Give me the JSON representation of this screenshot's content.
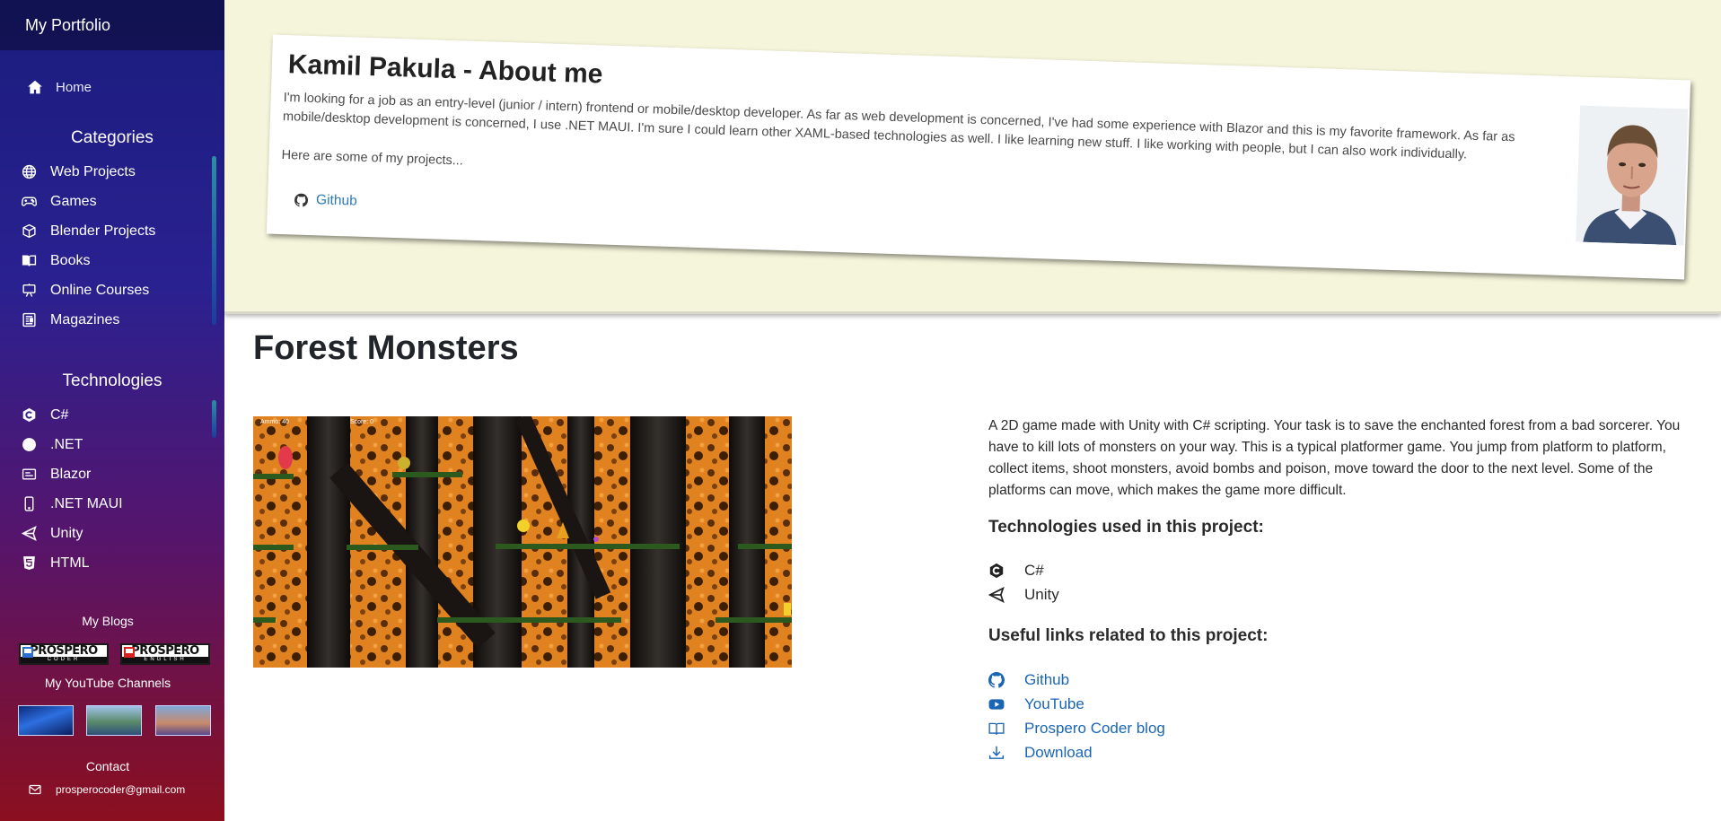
{
  "sidebar": {
    "brand": "My Portfolio",
    "home": "Home",
    "categories_title": "Categories",
    "categories": [
      {
        "label": "Web Projects",
        "icon": "globe-icon"
      },
      {
        "label": "Games",
        "icon": "gamepad-icon"
      },
      {
        "label": "Blender Projects",
        "icon": "box-icon"
      },
      {
        "label": "Books",
        "icon": "book-icon"
      },
      {
        "label": "Online Courses",
        "icon": "easel-icon"
      },
      {
        "label": "Magazines",
        "icon": "newspaper-icon"
      }
    ],
    "technologies_title": "Technologies",
    "technologies": [
      {
        "label": "C#",
        "icon": "csharp-icon"
      },
      {
        "label": ".NET",
        "icon": "dotnet-icon"
      },
      {
        "label": "Blazor",
        "icon": "blazor-icon"
      },
      {
        "label": ".NET MAUI",
        "icon": "phone-icon"
      },
      {
        "label": "Unity",
        "icon": "unity-icon"
      },
      {
        "label": "HTML",
        "icon": "html5-icon"
      }
    ],
    "blogs_title": "My Blogs",
    "blogs": [
      {
        "name": "PROSPERO",
        "sub": "CODER"
      },
      {
        "name": "PROSPERO",
        "sub": "ENGLISH"
      }
    ],
    "youtube_title": "My YouTube Channels",
    "contact_title": "Contact",
    "contact_email": "prosperocoder@gmail.com"
  },
  "about": {
    "title": "Kamil Pakula - About me",
    "text": "I'm looking for a job as an entry-level (junior / intern) frontend or mobile/desktop developer. As far as web development is concerned, I've had some experience with Blazor and this is my favorite framework. As far as mobile/desktop development is concerned, I use .NET MAUI. I'm sure I could learn other XAML-based technologies as well. I like learning new stuff. I like working with people, but I can also work individually.",
    "more": "Here are some of my projects...",
    "github_label": "Github"
  },
  "project": {
    "title": "Forest Monsters",
    "hud_ammo": "Ammo: 40",
    "hud_score": "Score: 0",
    "description": "A 2D game made with Unity with C# scripting. Your task is to save the enchanted forest from a bad sorcerer. You have to kill lots of monsters on your way. This is a typical platformer game. You jump from platform to platform, collect items, shoot monsters, avoid bombs and poison, move toward the door to the next level. Some of the platforms can move, which makes the game more difficult.",
    "tech_heading": "Technologies used in this project:",
    "technologies": [
      {
        "label": "C#",
        "icon": "csharp-icon"
      },
      {
        "label": "Unity",
        "icon": "unity-icon"
      }
    ],
    "links_heading": "Useful links related to this project:",
    "links": [
      {
        "label": "Github",
        "icon": "github-icon"
      },
      {
        "label": "YouTube",
        "icon": "youtube-icon"
      },
      {
        "label": "Prospero Coder blog",
        "icon": "book-open-icon"
      },
      {
        "label": "Download",
        "icon": "download-icon"
      }
    ]
  },
  "colors": {
    "sidebar_top": "#1a1c7e",
    "sidebar_bottom": "#8b0f1e",
    "banner_bg": "#f5f5db",
    "link": "#1a66b5"
  }
}
